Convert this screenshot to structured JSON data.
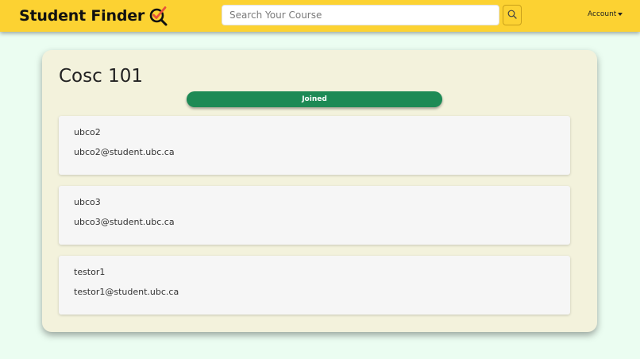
{
  "navbar": {
    "brand": "Student Finder",
    "brand_icon": "magnifier-check-icon",
    "search": {
      "placeholder": "Search Your Course",
      "value": ""
    },
    "search_button_icon": "search-icon",
    "account_label": "Account",
    "account_icon": "caret-down-icon"
  },
  "course": {
    "title": "Cosc 101",
    "status_label": "Joined",
    "students": [
      {
        "name": "ubco2",
        "email": "ubco2@student.ubc.ca"
      },
      {
        "name": "ubco3",
        "email": "ubco3@student.ubc.ca"
      },
      {
        "name": "testor1",
        "email": "testor1@student.ubc.ca"
      }
    ]
  },
  "colors": {
    "navbar": "#fcd232",
    "page_background": "#ebfdf1",
    "card_background": "#f3f2dc",
    "joined_button": "#1d8a55",
    "icon_check": "#e8523a"
  }
}
